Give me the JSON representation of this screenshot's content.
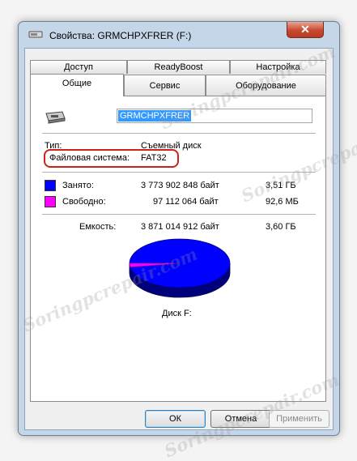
{
  "window": {
    "title": "Свойства: GRMCHPXFRER (F:)",
    "close_glyph": "✕"
  },
  "tabs": {
    "row1": [
      "Доступ",
      "ReadyBoost",
      "Настройка"
    ],
    "row2": [
      "Общие",
      "Сервис",
      "Оборудование"
    ],
    "active": "Общие"
  },
  "general": {
    "volume_label": "GRMCHPXFRER",
    "type_label": "Тип:",
    "type_value": "Съемный диск",
    "fs_label": "Файловая система:",
    "fs_value": "FAT32",
    "used_label": "Занято:",
    "used_bytes": "3 773 902 848 байт",
    "used_size": "3,51 ГБ",
    "free_label": "Свободно:",
    "free_bytes": "97 112 064 байт",
    "free_size": "92,6 МБ",
    "capacity_label": "Емкость:",
    "capacity_bytes": "3 871 014 912 байт",
    "capacity_size": "3,60 ГБ",
    "disk_label": "Диск F:"
  },
  "pie": {
    "used_color": "#0000ff",
    "free_color": "#ff00ff",
    "used_fraction": 0.975,
    "free_fraction": 0.025
  },
  "buttons": {
    "ok": "ОК",
    "cancel": "Отмена",
    "apply": "Применить"
  },
  "icons": {
    "title_icon": "drive-icon",
    "drive_icon": "removable-drive-icon",
    "close_icon": "close-icon"
  },
  "watermark": "Soringpcrepair.com"
}
